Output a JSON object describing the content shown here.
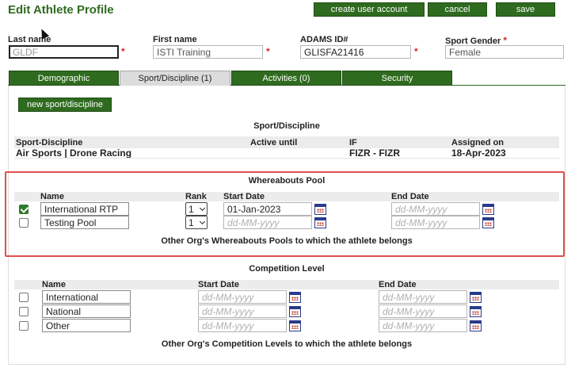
{
  "page": {
    "title": "Edit Athlete Profile",
    "actions": {
      "create_user": "create user account",
      "cancel": "cancel",
      "save": "save"
    }
  },
  "form": {
    "last_name": {
      "label": "Last name",
      "value": "GLDF"
    },
    "first_name": {
      "label": "First name",
      "value": "ISTI Training"
    },
    "adams_id": {
      "label": "ADAMS ID#",
      "value": "GLISFA21416"
    },
    "sport_gender": {
      "label": "Sport Gender",
      "value": "Female"
    },
    "required_mark": "*"
  },
  "tabs": [
    "Demographic",
    "Sport/Discipline (1)",
    "Activities (0)",
    "Security"
  ],
  "sport_discipline": {
    "new_button": "new sport/discipline",
    "title": "Sport/Discipline",
    "headers": {
      "sport": "Sport-Discipline",
      "active": "Active until",
      "if": "IF",
      "assigned": "Assigned on"
    },
    "rows": [
      {
        "sport": "Air Sports | Drone Racing",
        "active": "",
        "if": "FIZR - FIZR",
        "assigned": "18-Apr-2023"
      }
    ]
  },
  "whereabouts": {
    "title": "Whereabouts Pool",
    "headers": {
      "name": "Name",
      "rank": "Rank",
      "start": "Start Date",
      "end": "End Date"
    },
    "rows": [
      {
        "checked": true,
        "name": "International RTP",
        "rank": "1",
        "start": "01-Jan-2023",
        "end": "dd-MM-yyyy"
      },
      {
        "checked": false,
        "name": "Testing Pool",
        "rank": "1",
        "start": "dd-MM-yyyy",
        "end": "dd-MM-yyyy"
      }
    ],
    "other_org": "Other Org's Whereabouts Pools to which the athlete belongs"
  },
  "competition": {
    "title": "Competition Level",
    "headers": {
      "name": "Name",
      "start": "Start Date",
      "end": "End Date"
    },
    "rows": [
      {
        "name": "International",
        "start": "dd-MM-yyyy",
        "end": "dd-MM-yyyy"
      },
      {
        "name": "National",
        "start": "dd-MM-yyyy",
        "end": "dd-MM-yyyy"
      },
      {
        "name": "Other",
        "start": "dd-MM-yyyy",
        "end": "dd-MM-yyyy"
      }
    ],
    "other_org": "Other Org's Competition Levels to which the athlete belongs"
  },
  "colors": {
    "accent": "#2f6b1f",
    "highlight": "#e05050",
    "required": "#d9261c"
  },
  "icons": {
    "calendar": "calendar-icon",
    "check": "checkbox-icon",
    "chevron": "chevron-down-icon"
  }
}
